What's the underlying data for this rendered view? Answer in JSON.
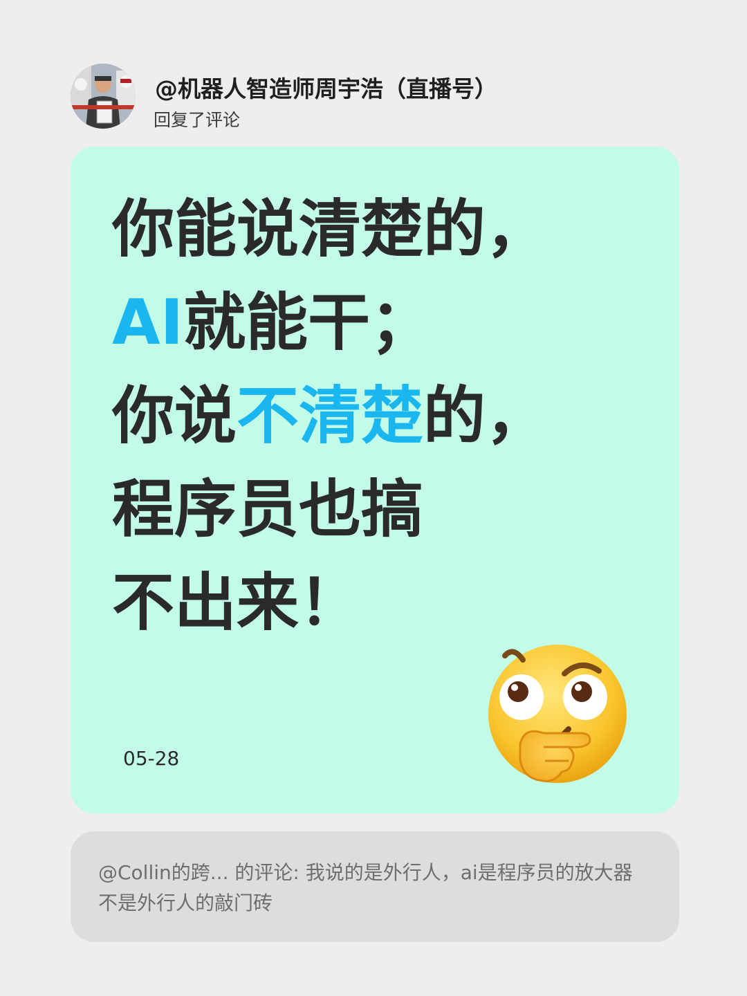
{
  "post": {
    "author": "@机器人智造师周宇浩（直播号）",
    "action": "回复了评论",
    "avatar_icon": "person-avatar",
    "headline": {
      "line1": "你能说清楚的，",
      "line2_highlight": "AI",
      "line2_rest": "就能干；",
      "line3_pre": "你说",
      "line3_highlight": "不清楚",
      "line3_post": "的，",
      "line4": "程序员也搞",
      "line5": "不出来！"
    },
    "date": "05-28",
    "emoji_icon": "thinking-face-icon",
    "card_color": "#c2fbe8",
    "highlight_color": "#1ab6ef"
  },
  "quote": {
    "text": "@Collin的跨... 的评论: 我说的是外行人，ai是程序员的放大器 不是外行人的敲门砖"
  }
}
